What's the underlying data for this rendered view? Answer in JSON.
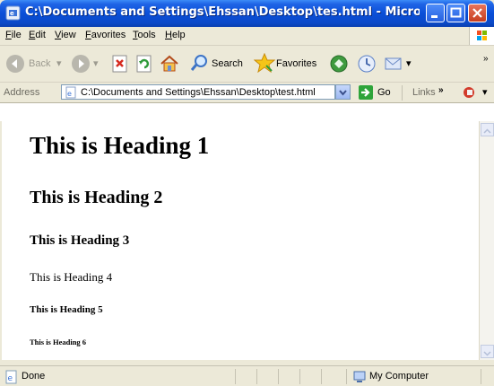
{
  "window": {
    "title": "C:\\Documents and Settings\\Ehssan\\Desktop\\tes.html - Microsoft ..."
  },
  "menubar": {
    "items": [
      "File",
      "Edit",
      "View",
      "Favorites",
      "Tools",
      "Help"
    ]
  },
  "toolbar": {
    "back_label": "Back",
    "search_label": "Search",
    "favorites_label": "Favorites"
  },
  "addressbar": {
    "label": "Address",
    "value": "C:\\Documents and Settings\\Ehssan\\Desktop\\test.html",
    "go_label": "Go",
    "links_label": "Links"
  },
  "page": {
    "h1": "This is Heading 1",
    "h2": "This is Heading 2",
    "h3": "This is Heading 3",
    "h4": "This is Heading 4",
    "h5": "This is Heading 5",
    "h6": "This is Heading 6"
  },
  "statusbar": {
    "status": "Done",
    "zone": "My Computer"
  },
  "colors": {
    "titlebar": "#0a4fd8",
    "chrome": "#ece9d8"
  }
}
